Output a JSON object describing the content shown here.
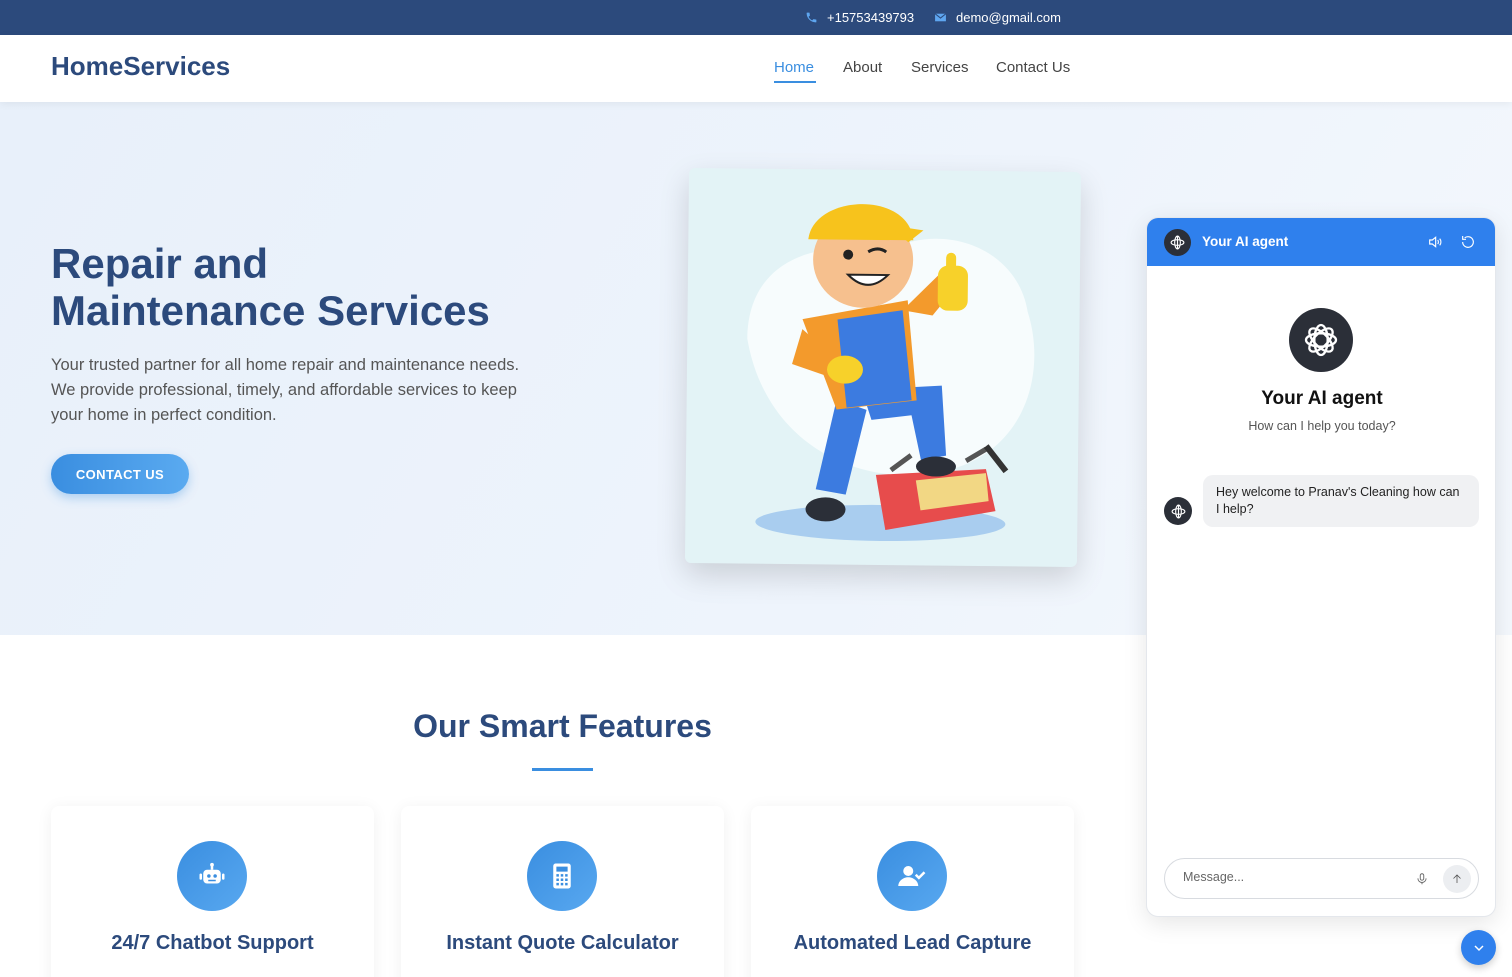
{
  "topbar": {
    "phone": "+15753439793",
    "email": "demo@gmail.com",
    "phone_icon": "phone-icon",
    "email_icon": "envelope-icon"
  },
  "navbar": {
    "brand": "HomeServices",
    "links": [
      {
        "label": "Home",
        "active": true
      },
      {
        "label": "About",
        "active": false
      },
      {
        "label": "Services",
        "active": false
      },
      {
        "label": "Contact Us",
        "active": false
      }
    ]
  },
  "hero": {
    "title_line1": "Repair and",
    "title_line2": "Maintenance Services",
    "text": "Your trusted partner for all home repair and maintenance needs. We provide professional, timely, and affordable services to keep your home in perfect condition.",
    "cta_label": "CONTACT US"
  },
  "features": {
    "title": "Our Smart Features",
    "cards": [
      {
        "title": "24/7 Chatbot Support",
        "icon": "robot-icon"
      },
      {
        "title": "Instant Quote Calculator",
        "icon": "calculator-icon"
      },
      {
        "title": "Automated Lead Capture",
        "icon": "user-check-icon"
      }
    ]
  },
  "chat": {
    "header_title": "Your AI agent",
    "agent_name": "Your AI agent",
    "agent_subtitle": "How can I help you today?",
    "welcome_message": "Hey welcome to Pranav's Cleaning how can I help?",
    "input_placeholder": "Message..."
  },
  "colors": {
    "primary": "#2c4a7c",
    "accent": "#3a8ee0",
    "chat_header": "#2f80ed"
  }
}
